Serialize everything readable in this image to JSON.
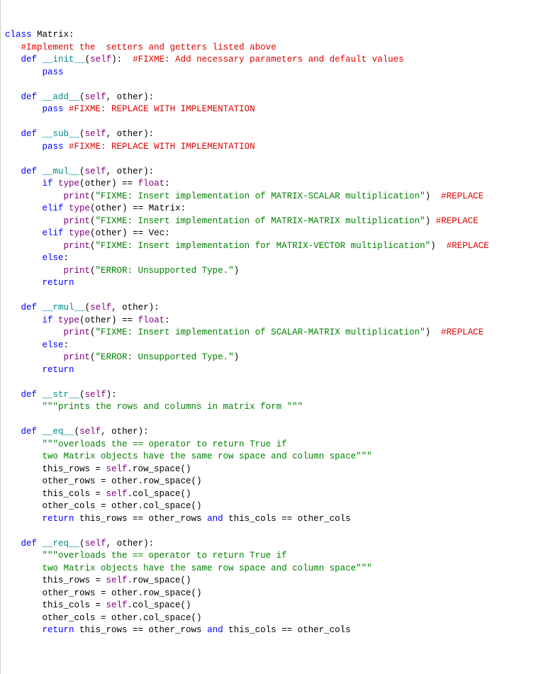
{
  "l0": [
    {
      "t": "class",
      "c": "kw"
    },
    {
      "t": " Matrix:",
      "c": "nc"
    }
  ],
  "l1": [
    {
      "t": "   ",
      "c": "op"
    },
    {
      "t": "#Implement the  setters and getters listed above",
      "c": "cmt"
    }
  ],
  "l2": [
    {
      "t": "   ",
      "c": "op"
    },
    {
      "t": "def",
      "c": "kw"
    },
    {
      "t": " ",
      "c": "op"
    },
    {
      "t": "__init__",
      "c": "fn"
    },
    {
      "t": "(",
      "c": "op"
    },
    {
      "t": "self",
      "c": "self"
    },
    {
      "t": "):  ",
      "c": "op"
    },
    {
      "t": "#FIXME: Add necessary parameters and default values",
      "c": "cmt"
    }
  ],
  "l3": [
    {
      "t": "       ",
      "c": "op"
    },
    {
      "t": "pass",
      "c": "kw"
    }
  ],
  "l4": [
    {
      "t": " ",
      "c": "op"
    }
  ],
  "l5": [
    {
      "t": "   ",
      "c": "op"
    },
    {
      "t": "def",
      "c": "kw"
    },
    {
      "t": " ",
      "c": "op"
    },
    {
      "t": "__add__",
      "c": "fn"
    },
    {
      "t": "(",
      "c": "op"
    },
    {
      "t": "self",
      "c": "self"
    },
    {
      "t": ", other):",
      "c": "op"
    }
  ],
  "l6": [
    {
      "t": "       ",
      "c": "op"
    },
    {
      "t": "pass",
      "c": "kw"
    },
    {
      "t": " ",
      "c": "op"
    },
    {
      "t": "#FIXME: REPLACE WITH IMPLEMENTATION",
      "c": "cmt"
    }
  ],
  "l7": [
    {
      "t": " ",
      "c": "op"
    }
  ],
  "l8": [
    {
      "t": "   ",
      "c": "op"
    },
    {
      "t": "def",
      "c": "kw"
    },
    {
      "t": " ",
      "c": "op"
    },
    {
      "t": "__sub__",
      "c": "fn"
    },
    {
      "t": "(",
      "c": "op"
    },
    {
      "t": "self",
      "c": "self"
    },
    {
      "t": ", other):",
      "c": "op"
    }
  ],
  "l9": [
    {
      "t": "       ",
      "c": "op"
    },
    {
      "t": "pass",
      "c": "kw"
    },
    {
      "t": " ",
      "c": "op"
    },
    {
      "t": "#FIXME: REPLACE WITH IMPLEMENTATION",
      "c": "cmt"
    }
  ],
  "l10": [
    {
      "t": " ",
      "c": "op"
    }
  ],
  "l11": [
    {
      "t": "   ",
      "c": "op"
    },
    {
      "t": "def",
      "c": "kw"
    },
    {
      "t": " ",
      "c": "op"
    },
    {
      "t": "__mul__",
      "c": "fn"
    },
    {
      "t": "(",
      "c": "op"
    },
    {
      "t": "self",
      "c": "self"
    },
    {
      "t": ", other):",
      "c": "op"
    }
  ],
  "l12": [
    {
      "t": "       ",
      "c": "op"
    },
    {
      "t": "if",
      "c": "kw"
    },
    {
      "t": " ",
      "c": "op"
    },
    {
      "t": "type",
      "c": "self"
    },
    {
      "t": "(other) == ",
      "c": "op"
    },
    {
      "t": "float",
      "c": "self"
    },
    {
      "t": ":",
      "c": "op"
    }
  ],
  "l13": [
    {
      "t": "           ",
      "c": "op"
    },
    {
      "t": "print",
      "c": "self"
    },
    {
      "t": "(",
      "c": "op"
    },
    {
      "t": "\"FIXME: Insert implementation of MATRIX-SCALAR multiplication\"",
      "c": "str"
    },
    {
      "t": ")  ",
      "c": "op"
    },
    {
      "t": "#REPLACE",
      "c": "cmt"
    }
  ],
  "l14": [
    {
      "t": "       ",
      "c": "op"
    },
    {
      "t": "elif",
      "c": "kw"
    },
    {
      "t": " ",
      "c": "op"
    },
    {
      "t": "type",
      "c": "self"
    },
    {
      "t": "(other) == Matrix:",
      "c": "op"
    }
  ],
  "l15": [
    {
      "t": "           ",
      "c": "op"
    },
    {
      "t": "print",
      "c": "self"
    },
    {
      "t": "(",
      "c": "op"
    },
    {
      "t": "\"FIXME: Insert implementation of MATRIX-MATRIX multiplication\"",
      "c": "str"
    },
    {
      "t": ") ",
      "c": "op"
    },
    {
      "t": "#REPLACE",
      "c": "cmt"
    }
  ],
  "l16": [
    {
      "t": "       ",
      "c": "op"
    },
    {
      "t": "elif",
      "c": "kw"
    },
    {
      "t": " ",
      "c": "op"
    },
    {
      "t": "type",
      "c": "self"
    },
    {
      "t": "(other) == Vec:",
      "c": "op"
    }
  ],
  "l17": [
    {
      "t": "           ",
      "c": "op"
    },
    {
      "t": "print",
      "c": "self"
    },
    {
      "t": "(",
      "c": "op"
    },
    {
      "t": "\"FIXME: Insert implementation for MATRIX-VECTOR multiplication\"",
      "c": "str"
    },
    {
      "t": ")  ",
      "c": "op"
    },
    {
      "t": "#REPLACE",
      "c": "cmt"
    }
  ],
  "l18": [
    {
      "t": "       ",
      "c": "op"
    },
    {
      "t": "else",
      "c": "kw"
    },
    {
      "t": ":",
      "c": "op"
    }
  ],
  "l19": [
    {
      "t": "           ",
      "c": "op"
    },
    {
      "t": "print",
      "c": "self"
    },
    {
      "t": "(",
      "c": "op"
    },
    {
      "t": "\"ERROR: Unsupported Type.\"",
      "c": "str"
    },
    {
      "t": ")",
      "c": "op"
    }
  ],
  "l20": [
    {
      "t": "       ",
      "c": "op"
    },
    {
      "t": "return",
      "c": "kw"
    }
  ],
  "l21": [
    {
      "t": " ",
      "c": "op"
    }
  ],
  "l22": [
    {
      "t": "   ",
      "c": "op"
    },
    {
      "t": "def",
      "c": "kw"
    },
    {
      "t": " ",
      "c": "op"
    },
    {
      "t": "__rmul__",
      "c": "fn"
    },
    {
      "t": "(",
      "c": "op"
    },
    {
      "t": "self",
      "c": "self"
    },
    {
      "t": ", other):",
      "c": "op"
    }
  ],
  "l23": [
    {
      "t": "       ",
      "c": "op"
    },
    {
      "t": "if",
      "c": "kw"
    },
    {
      "t": " ",
      "c": "op"
    },
    {
      "t": "type",
      "c": "self"
    },
    {
      "t": "(other) == ",
      "c": "op"
    },
    {
      "t": "float",
      "c": "self"
    },
    {
      "t": ":",
      "c": "op"
    }
  ],
  "l24": [
    {
      "t": "           ",
      "c": "op"
    },
    {
      "t": "print",
      "c": "self"
    },
    {
      "t": "(",
      "c": "op"
    },
    {
      "t": "\"FIXME: Insert implementation of SCALAR-MATRIX multiplication\"",
      "c": "str"
    },
    {
      "t": ")  ",
      "c": "op"
    },
    {
      "t": "#REPLACE",
      "c": "cmt"
    }
  ],
  "l25": [
    {
      "t": "       ",
      "c": "op"
    },
    {
      "t": "else",
      "c": "kw"
    },
    {
      "t": ":",
      "c": "op"
    }
  ],
  "l26": [
    {
      "t": "           ",
      "c": "op"
    },
    {
      "t": "print",
      "c": "self"
    },
    {
      "t": "(",
      "c": "op"
    },
    {
      "t": "\"ERROR: Unsupported Type.\"",
      "c": "str"
    },
    {
      "t": ")",
      "c": "op"
    }
  ],
  "l27": [
    {
      "t": "       ",
      "c": "op"
    },
    {
      "t": "return",
      "c": "kw"
    }
  ],
  "l28": [
    {
      "t": " ",
      "c": "op"
    }
  ],
  "l29": [
    {
      "t": "   ",
      "c": "op"
    },
    {
      "t": "def",
      "c": "kw"
    },
    {
      "t": " ",
      "c": "op"
    },
    {
      "t": "__str__",
      "c": "fn"
    },
    {
      "t": "(",
      "c": "op"
    },
    {
      "t": "self",
      "c": "self"
    },
    {
      "t": "):",
      "c": "op"
    }
  ],
  "l30": [
    {
      "t": "       ",
      "c": "op"
    },
    {
      "t": "\"\"\"prints the rows and columns in matrix form \"\"\"",
      "c": "str"
    }
  ],
  "l31": [
    {
      "t": " ",
      "c": "op"
    }
  ],
  "l32": [
    {
      "t": "   ",
      "c": "op"
    },
    {
      "t": "def",
      "c": "kw"
    },
    {
      "t": " ",
      "c": "op"
    },
    {
      "t": "__eq__",
      "c": "fn"
    },
    {
      "t": "(",
      "c": "op"
    },
    {
      "t": "self",
      "c": "self"
    },
    {
      "t": ", other):",
      "c": "op"
    }
  ],
  "l33": [
    {
      "t": "       ",
      "c": "op"
    },
    {
      "t": "\"\"\"overloads the == operator to return True if",
      "c": "str"
    }
  ],
  "l34": [
    {
      "t": "       ",
      "c": "op"
    },
    {
      "t": "two Matrix objects have the same row space and column space\"\"\"",
      "c": "str"
    }
  ],
  "l35": [
    {
      "t": "       this_rows = ",
      "c": "op"
    },
    {
      "t": "self",
      "c": "self"
    },
    {
      "t": ".row_space()",
      "c": "op"
    }
  ],
  "l36": [
    {
      "t": "       other_rows = other.row_space()",
      "c": "op"
    }
  ],
  "l37": [
    {
      "t": "       this_cols = ",
      "c": "op"
    },
    {
      "t": "self",
      "c": "self"
    },
    {
      "t": ".col_space()",
      "c": "op"
    }
  ],
  "l38": [
    {
      "t": "       other_cols = other.col_space()",
      "c": "op"
    }
  ],
  "l39": [
    {
      "t": "       ",
      "c": "op"
    },
    {
      "t": "return",
      "c": "kw"
    },
    {
      "t": " this_rows == other_rows ",
      "c": "op"
    },
    {
      "t": "and",
      "c": "kw"
    },
    {
      "t": " this_cols == other_cols",
      "c": "op"
    }
  ],
  "l40": [
    {
      "t": " ",
      "c": "op"
    }
  ],
  "l41": [
    {
      "t": "   ",
      "c": "op"
    },
    {
      "t": "def",
      "c": "kw"
    },
    {
      "t": " ",
      "c": "op"
    },
    {
      "t": "__req__",
      "c": "fn"
    },
    {
      "t": "(",
      "c": "op"
    },
    {
      "t": "self",
      "c": "self"
    },
    {
      "t": ", other):",
      "c": "op"
    }
  ],
  "l42": [
    {
      "t": "       ",
      "c": "op"
    },
    {
      "t": "\"\"\"overloads the == operator to return True if",
      "c": "str"
    }
  ],
  "l43": [
    {
      "t": "       ",
      "c": "op"
    },
    {
      "t": "two Matrix objects have the same row space and column space\"\"\"",
      "c": "str"
    }
  ],
  "l44": [
    {
      "t": "       this_rows = ",
      "c": "op"
    },
    {
      "t": "self",
      "c": "self"
    },
    {
      "t": ".row_space()",
      "c": "op"
    }
  ],
  "l45": [
    {
      "t": "       other_rows = other.row_space()",
      "c": "op"
    }
  ],
  "l46": [
    {
      "t": "       this_cols = ",
      "c": "op"
    },
    {
      "t": "self",
      "c": "self"
    },
    {
      "t": ".col_space()",
      "c": "op"
    }
  ],
  "l47": [
    {
      "t": "       other_cols = other.col_space()",
      "c": "op"
    }
  ],
  "l48": [
    {
      "t": "       ",
      "c": "op"
    },
    {
      "t": "return",
      "c": "kw"
    },
    {
      "t": " this_rows == other_rows ",
      "c": "op"
    },
    {
      "t": "and",
      "c": "kw"
    },
    {
      "t": " this_cols == other_cols",
      "c": "op"
    }
  ]
}
